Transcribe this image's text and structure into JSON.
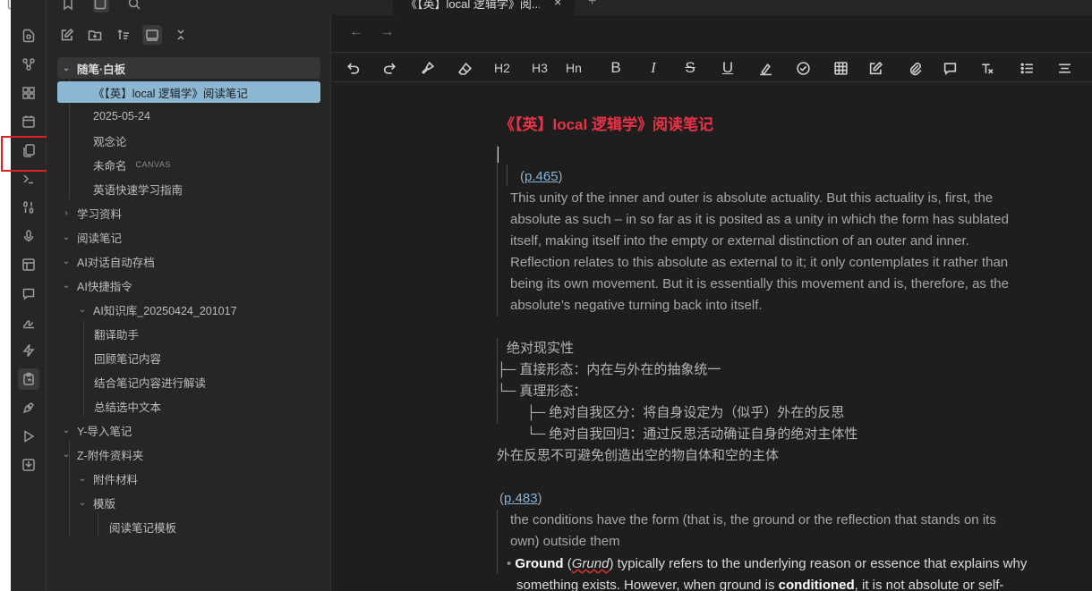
{
  "window": {
    "tab_title": "《【英】local 逻辑学》阅...",
    "tab_close": "×",
    "tab_add": "+"
  },
  "ribbon": {
    "icons": [
      "file-search-icon",
      "graph-icon",
      "grid-icon",
      "calendar-icon",
      "files-icon",
      "terminal-icon",
      "binary-icon",
      "mic-icon",
      "layout-icon",
      "chat-icon",
      "signature-icon",
      "lightning-icon",
      "clipboard-icon",
      "pen-tool-icon",
      "play-icon",
      "download-icon"
    ],
    "active_icon": "clipboard-icon"
  },
  "sidebar": {
    "toolbar_icons": [
      "new-note-icon",
      "new-folder-icon",
      "sort-icon",
      "collapse-view-icon",
      "collapse-all-icon"
    ],
    "tree": {
      "root_folder": "随笔·白板",
      "root_children": [
        {
          "label": "《【英】local 逻辑学》阅读笔记",
          "selected": true
        },
        {
          "label": "2025-05-24"
        },
        {
          "label": "观念论"
        },
        {
          "label": "未命名",
          "tag": "CANVAS"
        },
        {
          "label": "英语快速学习指南"
        }
      ],
      "folders": [
        {
          "label": "学习资料",
          "chev": "›"
        },
        {
          "label": "阅读笔记",
          "chev": "⌄"
        },
        {
          "label": "AI对话自动存档",
          "chev": "⌄"
        },
        {
          "label": "AI快捷指令",
          "chev": "⌄"
        }
      ],
      "ai_sub_folder": "AI知识库_20250424_201017",
      "ai_items": [
        "翻译助手",
        "回顾笔记内容",
        "结合笔记内容进行解读",
        "总结选中文本"
      ],
      "more_folders": [
        {
          "label": "Y-导入笔记",
          "chev": "⌄"
        },
        {
          "label": "Z-附件资料夹",
          "chev": "⌄"
        }
      ],
      "z_sub": [
        {
          "label": "附件材料",
          "chev": "⌄"
        },
        {
          "label": "模版",
          "chev": "⌄"
        }
      ],
      "template_item": "阅读笔记模板"
    }
  },
  "editor": {
    "nav_back": "←",
    "nav_forward": "→",
    "toolbar": {
      "h2": "H2",
      "h3": "H3",
      "hn": "Hn",
      "bold": "B",
      "italic": "I",
      "strike": "S",
      "underline": "U"
    },
    "title": "《【英】local 逻辑学》阅读笔记",
    "quote1": {
      "link": "p.465",
      "lines": [
        "This unity of the inner and outer is absolute actuality. But this actuality is, first, the",
        "absolute as such – in so far as it is posited as a unity in which the form has sublated",
        "itself, making itself into the empty or external distinction of an outer and inner.",
        "Reflection relates to this absolute as external to it; it only contemplates it rather than",
        "being its own movement. But it is essentially this movement and is, therefore, as the",
        "absolute’s negative turning back into itself."
      ]
    },
    "tree_block": {
      "lines": [
        "绝对现实性",
        "├─ 直接形态：内在与外在的抽象统一",
        "└─ 真理形态：",
        "├─ 绝对自我区分：将自身设定为（似乎）外在的反思",
        "└─ 绝对自我回归：通过反思活动确证自身的绝对主体性"
      ],
      "footer": "外在反思不可避免创造出空的物自体和空的主体"
    },
    "quote2": {
      "link": "p.483",
      "lines": [
        "the conditions have the form (that is, the ground or the reflection that stands on its",
        "own) outside them"
      ]
    },
    "bullet": {
      "bold1": "Ground",
      "paren_open": " (",
      "italic": "Grund",
      "rest1": ") typically refers to the underlying reason or essence that explains why",
      "line2_pre": "something exists. However, when ground is ",
      "bold2": "conditioned",
      "line2_post": ", it is not absolute or self-"
    }
  }
}
